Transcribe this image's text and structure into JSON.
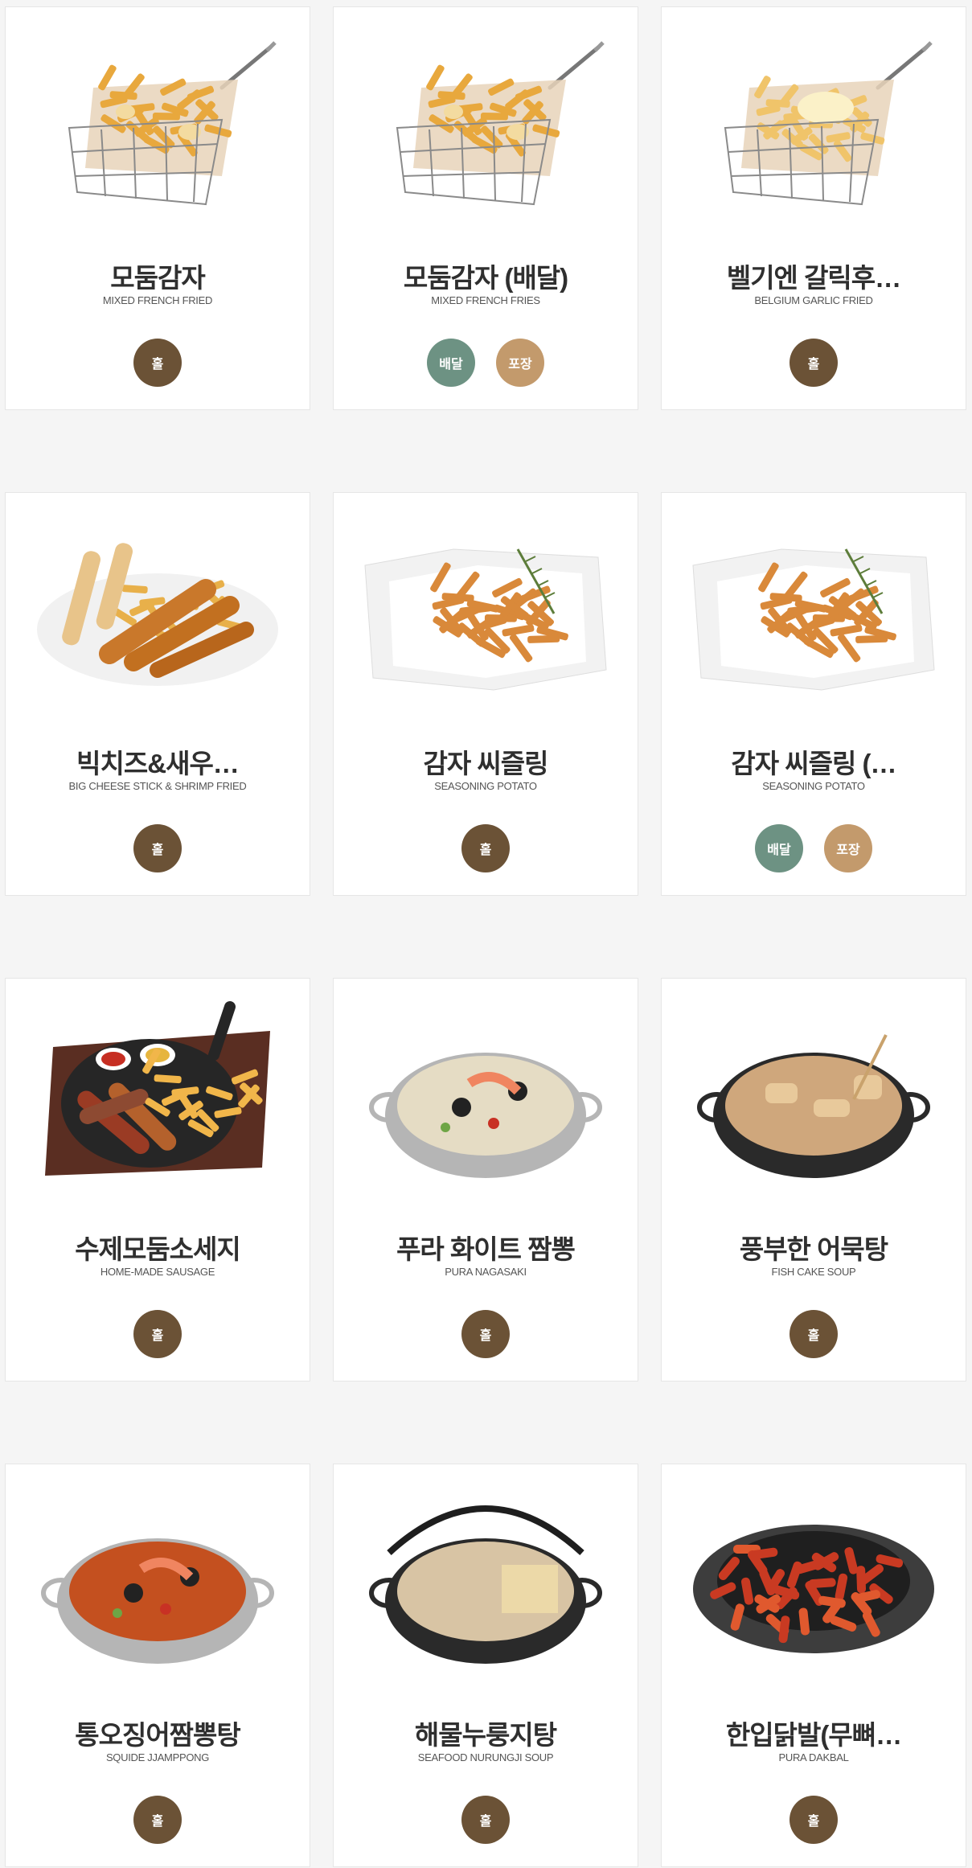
{
  "badge_colors": {
    "홀": "#6b5236",
    "배달": "#6d9283",
    "포장": "#c39a6c"
  },
  "menu_items": [
    {
      "name_ko": "모둠감자",
      "name_en": "MIXED FRENCH FRIED",
      "badges": [
        "홀"
      ],
      "image": "fries-basket"
    },
    {
      "name_ko": "모둠감자 (배달)",
      "name_en": "MIXED FRENCH FRIES",
      "badges": [
        "배달",
        "포장"
      ],
      "image": "fries-basket"
    },
    {
      "name_ko": "벨기엔 갈릭후…",
      "name_en": "BELGIUM GARLIC FRIED",
      "badges": [
        "홀"
      ],
      "image": "garlic-fries-basket"
    },
    {
      "name_ko": "빅치즈&새우…",
      "name_en": "BIG CHEESE STICK & SHRIMP FRIED",
      "badges": [
        "홀"
      ],
      "image": "shrimp-plate"
    },
    {
      "name_ko": "감자 씨즐링",
      "name_en": "SEASONING POTATO",
      "badges": [
        "홀"
      ],
      "image": "seasoned-fries"
    },
    {
      "name_ko": "감자 씨즐링 (…",
      "name_en": "SEASONING POTATO",
      "badges": [
        "배달",
        "포장"
      ],
      "image": "seasoned-fries"
    },
    {
      "name_ko": "수제모둠소세지",
      "name_en": "HOME-MADE SAUSAGE",
      "badges": [
        "홀"
      ],
      "image": "sausage-board"
    },
    {
      "name_ko": "푸라 화이트 짬뽕",
      "name_en": "PURA NAGASAKI",
      "badges": [
        "홀"
      ],
      "image": "white-jjamppong-pot"
    },
    {
      "name_ko": "풍부한 어묵탕",
      "name_en": "FISH CAKE SOUP",
      "badges": [
        "홀"
      ],
      "image": "fishcake-pot"
    },
    {
      "name_ko": "통오징어짬뽕탕",
      "name_en": "SQUIDE JJAMPPONG",
      "badges": [
        "홀"
      ],
      "image": "squid-jjamppong-pot"
    },
    {
      "name_ko": "해물누룽지탕",
      "name_en": "SEAFOOD NURUNGJI SOUP",
      "badges": [
        "홀"
      ],
      "image": "nurungji-pot"
    },
    {
      "name_ko": "한입닭발(무뼈…",
      "name_en": "PURA DAKBAL",
      "badges": [
        "홀"
      ],
      "image": "dakbal-plate"
    }
  ]
}
